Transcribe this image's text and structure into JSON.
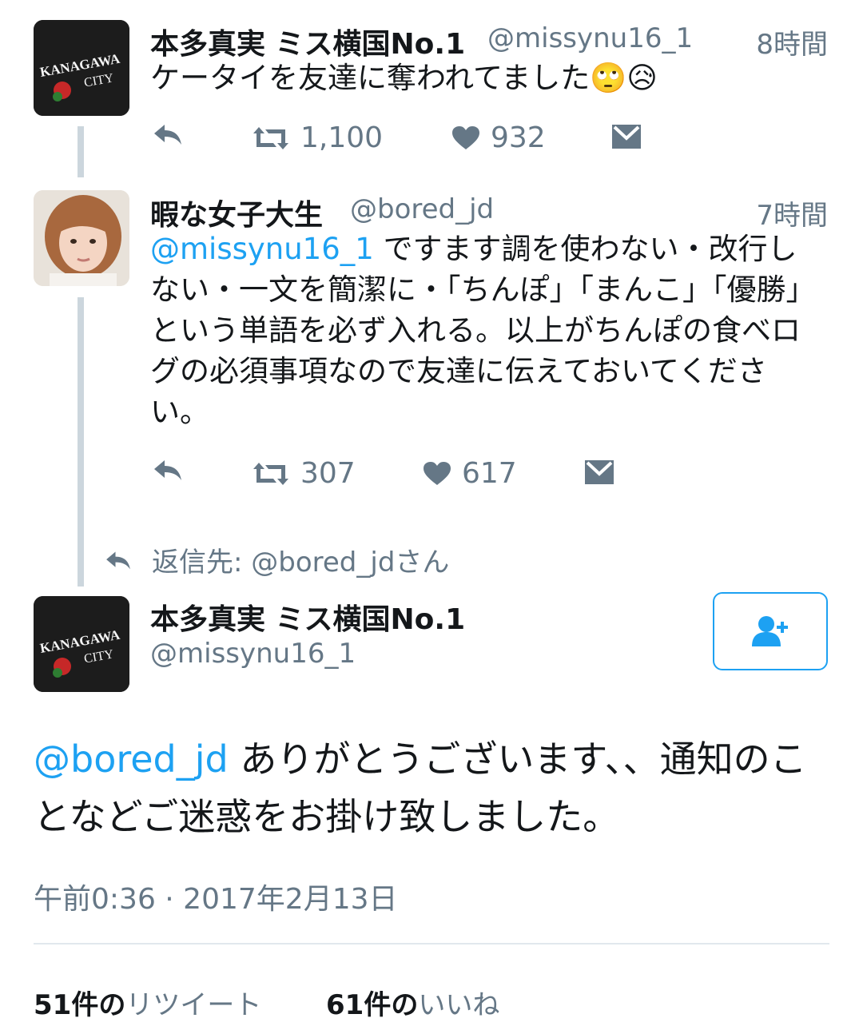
{
  "tweets": [
    {
      "name": "本多真実 ミス横国No.1",
      "handle": "@missynu16_1",
      "time": "8時間",
      "text": "ケータイを友達に奪われてました",
      "emoji": [
        "🙄",
        "😥"
      ],
      "avatar_text": [
        "KANAGAWA",
        "CITY"
      ],
      "retweets": "1,100",
      "likes": "932"
    },
    {
      "name": "暇な女子大生",
      "handle": "@bored_jd",
      "time": "7時間",
      "mention": "@missynu16_1",
      "text": "ですます調を使わない・改行しない・一文を簡潔に・「ちんぽ」「まんこ」「優勝」という単語を必ず入れる。以上がちんぽの食べログの必須事項なので友達に伝えておいてください。",
      "retweets": "307",
      "likes": "617"
    }
  ],
  "reply_to": "返信先: @bored_jdさん",
  "main_tweet": {
    "name": "本多真実 ミス横国No.1",
    "handle": "@missynu16_1",
    "avatar_text": [
      "KANAGAWA",
      "CITY"
    ],
    "mention": "@bored_jd",
    "text": "ありがとうございます、、通知のことなどご迷惑をお掛け致しました。",
    "timestamp": "午前0:36 · 2017年2月13日"
  },
  "stats": {
    "retweet_count": "51件の",
    "retweet_label": "リツイート",
    "like_count": "61件の",
    "like_label": "いいね"
  },
  "icons": [
    "reply-icon",
    "retweet-icon",
    "heart-icon",
    "message-icon",
    "follow-icon"
  ],
  "colors": {
    "accent": "#1da1f2",
    "muted": "#657786",
    "line": "#ccd6dd"
  }
}
